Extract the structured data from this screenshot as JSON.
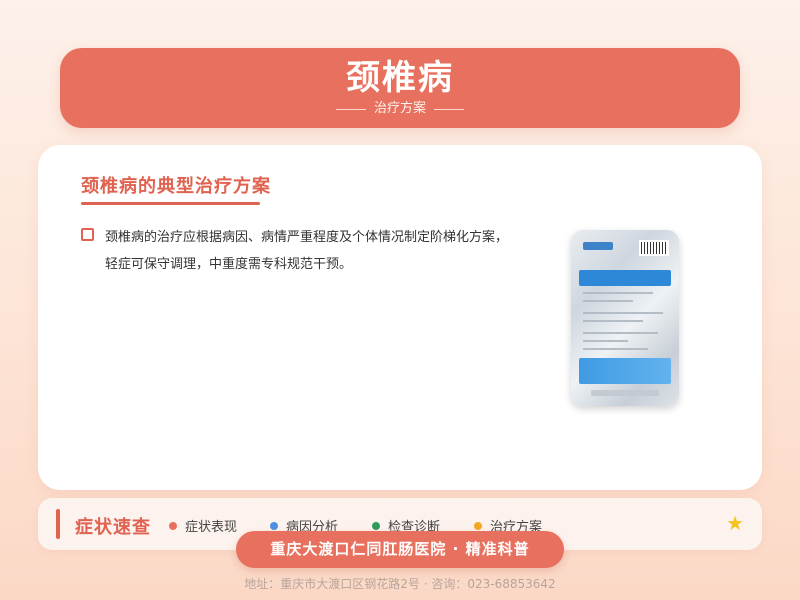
{
  "header": {
    "title": "颈椎病",
    "subtitle": "治疗方案"
  },
  "card": {
    "section_title": "颈椎病的典型治疗方案",
    "paragraph": "颈椎病的治疗应根据病因、病情严重程度及个体情况制定阶梯化方案，轻症可保守调理，中重度需专科规范干预。"
  },
  "quicknav": {
    "title": "症状速查",
    "items": [
      {
        "label": "症状表现",
        "color": "#e8705e"
      },
      {
        "label": "病因分析",
        "color": "#4a90e2"
      },
      {
        "label": "检查诊断",
        "color": "#2e9c5a"
      },
      {
        "label": "治疗方案",
        "color": "#f5a623"
      }
    ]
  },
  "footer": {
    "hospital": "重庆大渡口仁同肛肠医院 · 精准科普",
    "address": "地址：重庆市大渡口区钢花路2号 · 咨询：023-68853642"
  }
}
